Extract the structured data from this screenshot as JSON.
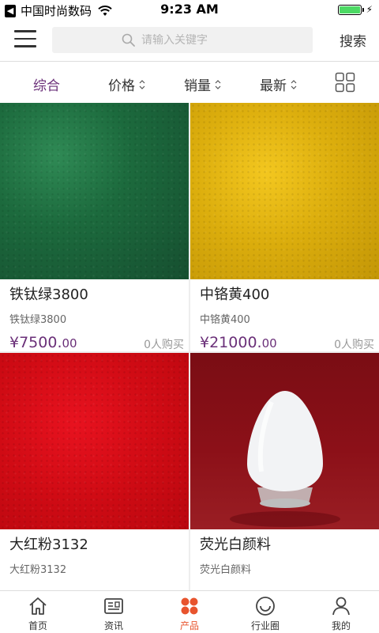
{
  "status_bar": {
    "carrier": "中国时尚数码",
    "time": "9:23 AM"
  },
  "header": {
    "search_placeholder": "请输入关键字",
    "search_button": "搜索"
  },
  "filters": [
    {
      "label": "综合",
      "active": true
    },
    {
      "label": "价格",
      "active": false
    },
    {
      "label": "销量",
      "active": false
    },
    {
      "label": "最新",
      "active": false
    }
  ],
  "products": [
    {
      "name": "铁钛绿3800",
      "subtitle": "铁钛绿3800",
      "price_main": "¥7500.",
      "price_cents": "00",
      "buyers": "0人购买",
      "swatch": "green"
    },
    {
      "name": "中铬黄400",
      "subtitle": "中铬黄400",
      "price_main": "¥21000.",
      "price_cents": "00",
      "buyers": "0人购买",
      "swatch": "yellow"
    },
    {
      "name": "大红粉3132",
      "subtitle": "大红粉3132",
      "price_main": "",
      "price_cents": "",
      "buyers": "",
      "swatch": "red"
    },
    {
      "name": "荧光白颜料",
      "subtitle": "荧光白颜料",
      "price_main": "",
      "price_cents": "",
      "buyers": "",
      "swatch": "maroon"
    }
  ],
  "tabs": [
    {
      "label": "首页",
      "icon": "home-icon",
      "active": false
    },
    {
      "label": "资讯",
      "icon": "news-icon",
      "active": false
    },
    {
      "label": "产品",
      "icon": "products-icon",
      "active": true
    },
    {
      "label": "行业圈",
      "icon": "circle-icon",
      "active": false
    },
    {
      "label": "我的",
      "icon": "profile-icon",
      "active": false
    }
  ],
  "colors": {
    "accent": "#6a2f78",
    "tab_active": "#e8542e",
    "battery": "#4cd964"
  }
}
